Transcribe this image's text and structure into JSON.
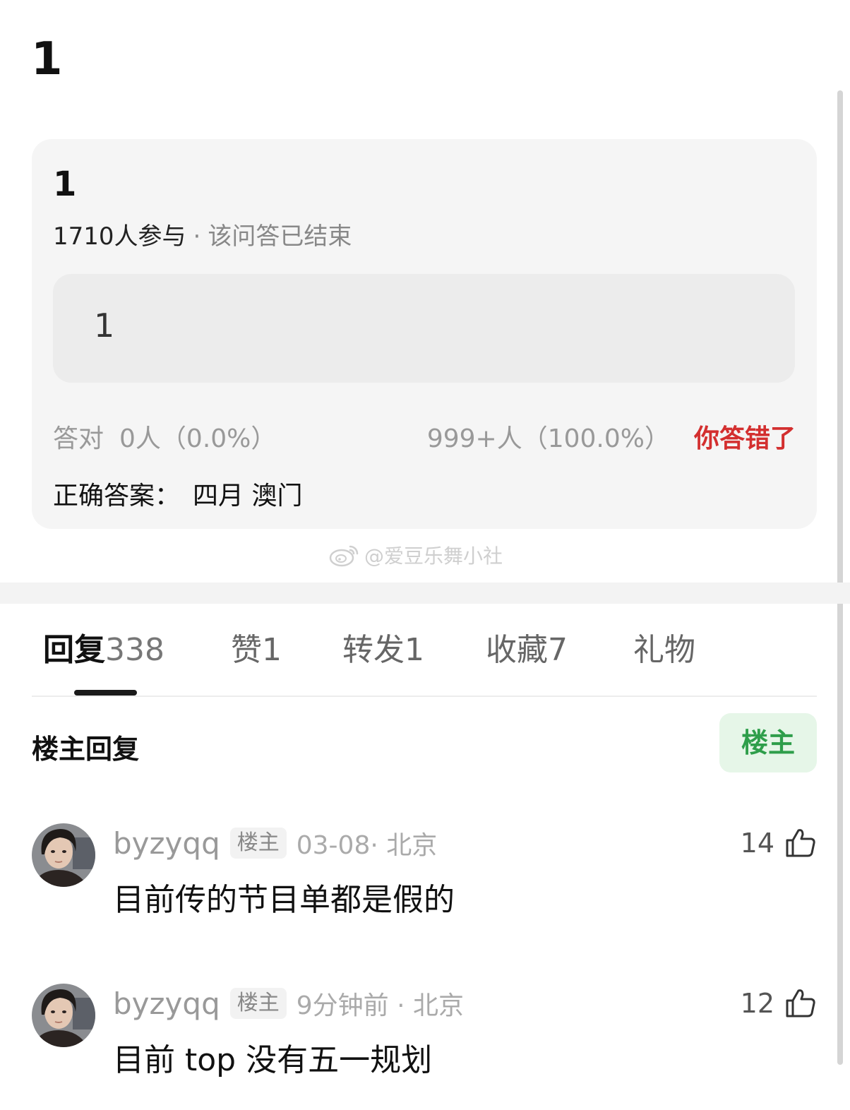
{
  "page": {
    "title": "1"
  },
  "quiz": {
    "question": "1",
    "participants": "1710人参与",
    "separator": "·",
    "status": "该问答已结束",
    "option_text": "1",
    "correct_label": "答对",
    "correct_stats": "0人（0.0%）",
    "wrong_stats": "999+人（100.0%）",
    "result_label": "你答错了",
    "answer_label": "正确答案：",
    "answer_value": "四月 澳门",
    "colors": {
      "card_bg": "#f5f5f5",
      "wrong": "#d32f2f"
    }
  },
  "watermark": {
    "text": "@爱豆乐舞小社",
    "icon": "weibo-icon"
  },
  "tabs": [
    {
      "label": "回复",
      "count": "338",
      "active": true
    },
    {
      "label": "赞",
      "count": "1",
      "active": false
    },
    {
      "label": "转发",
      "count": "1",
      "active": false
    },
    {
      "label": "收藏",
      "count": "7",
      "active": false
    },
    {
      "label": "礼物",
      "count": "",
      "active": false
    }
  ],
  "owner_replies": {
    "title": "楼主回复",
    "filter_button": "楼主",
    "accent": "#2e9e4a"
  },
  "comments": [
    {
      "username": "byzyqq",
      "tag": "楼主",
      "meta": "03-08· 北京",
      "text": "目前传的节目单都是假的",
      "likes": "14"
    },
    {
      "username": "byzyqq",
      "tag": "楼主",
      "meta": "9分钟前 · 北京",
      "text": "目前 top 没有五一规划",
      "likes": "12"
    }
  ]
}
